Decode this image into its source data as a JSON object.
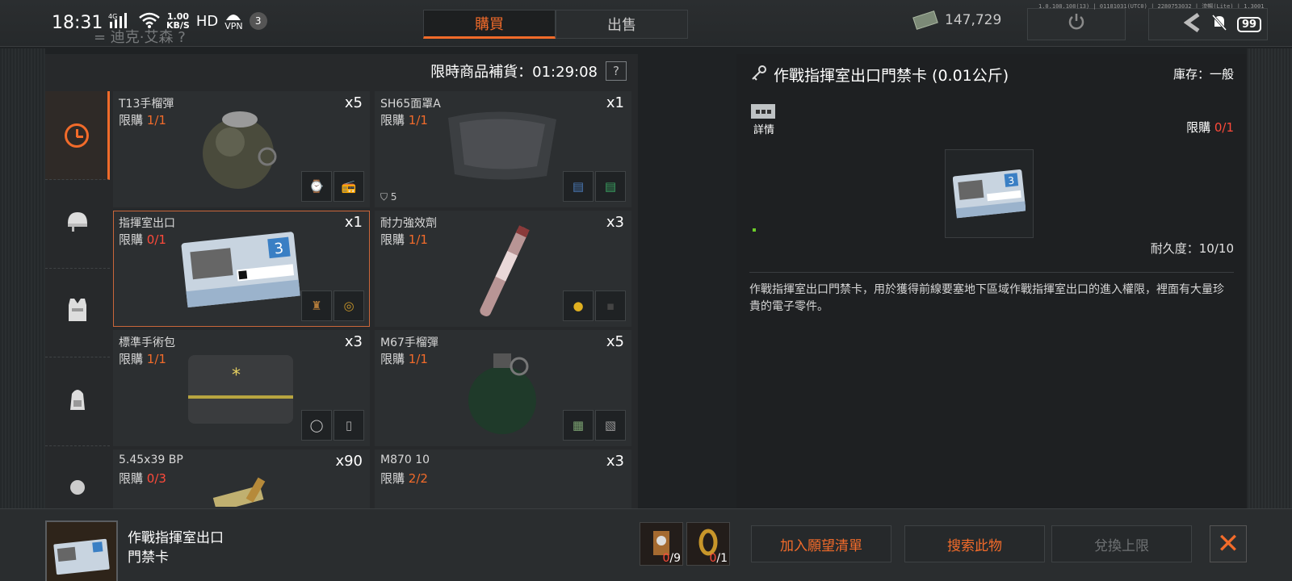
{
  "status_bar": {
    "time": "18:31",
    "network": "4G",
    "speed_value": "1.00",
    "speed_unit": "KB/S",
    "hd": "HD",
    "vpn": "VPN",
    "notification_count": "3",
    "battery": "99",
    "build_info": "1.0.108.108(13) | 01181031(UTC0) | 2280753032 | 流暢(Lite) | 1.3001"
  },
  "ghost_name": "= 迪克·艾森 ?",
  "tabs": [
    {
      "label": "購買",
      "active": true
    },
    {
      "label": "出售",
      "active": false
    }
  ],
  "currency": "147,729",
  "restock": {
    "label": "限時商品補貨：01:29:08",
    "help": "?"
  },
  "items": [
    {
      "name": "T13手榴彈",
      "limit_label": "限購",
      "limit": "1/1",
      "qty": "x5"
    },
    {
      "name": "SH65面罩A",
      "limit_label": "限購",
      "limit": "1/1",
      "qty": "x1",
      "shield": "5"
    },
    {
      "name": "指揮室出口",
      "limit_label": "限購",
      "limit": "0/1",
      "qty": "x1",
      "selected": true
    },
    {
      "name": "耐力強效劑",
      "limit_label": "限購",
      "limit": "1/1",
      "qty": "x3"
    },
    {
      "name": "標準手術包",
      "limit_label": "限購",
      "limit": "1/1",
      "qty": "x3"
    },
    {
      "name": "M67手榴彈",
      "limit_label": "限購",
      "limit": "1/1",
      "qty": "x5"
    },
    {
      "name": "5.45x39 BP",
      "limit_label": "限購",
      "limit": "0/3",
      "qty": "x90"
    },
    {
      "name": "M870 10",
      "limit_label": "限購",
      "limit": "2/2",
      "qty": "x3"
    }
  ],
  "detail": {
    "title": "作戰指揮室出口門禁卡 (0.01公斤)",
    "stock": "庫存：一般",
    "detail_btn": "詳情",
    "limit_label": "限購",
    "limit": "0/1",
    "durability": "耐久度：10/10",
    "description": "作戰指揮室出口門禁卡，用於獲得前線要塞地下區域作戰指揮室出口的進入權限，裡面有大量珍貴的電子零件。"
  },
  "bottom": {
    "item_name": "作戰指揮室出口門禁卡",
    "mat1_have": "0",
    "mat1_need": "/9",
    "mat2_have": "0",
    "mat2_need": "/1",
    "wishlist_btn": "加入願望清單",
    "search_btn": "搜索此物",
    "exchange_btn": "兌換上限",
    "close": "✕"
  },
  "colors": {
    "accent": "#f26b2a",
    "limit_zero": "#ff4a3a"
  }
}
